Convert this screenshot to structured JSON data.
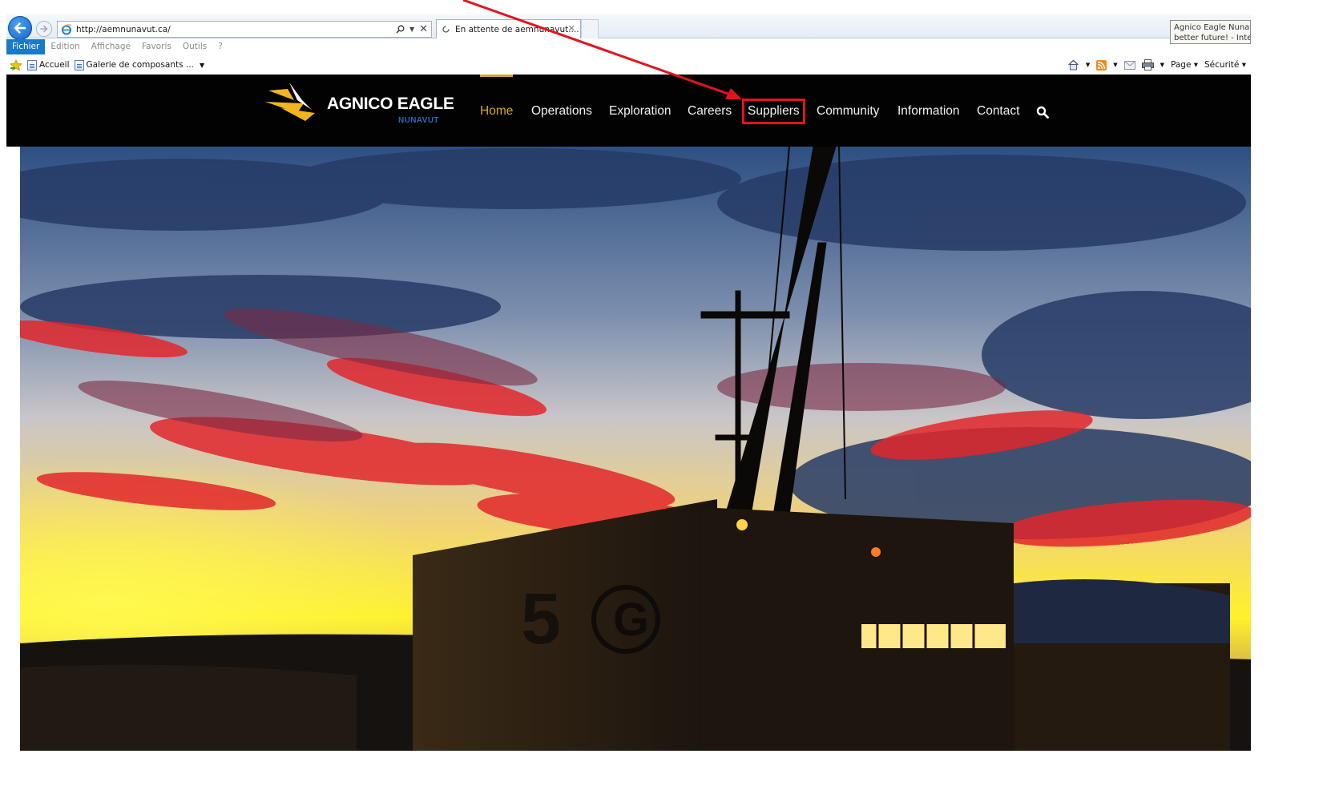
{
  "browser": {
    "url": "http://aemnunavut.ca/",
    "tab_title": "En attente de aemnunavut....",
    "tooltip_line1": "Agnico Eagle Nunavut",
    "tooltip_line2": "better future! - Internet",
    "menu": [
      "Fichier",
      "Edition",
      "Affichage",
      "Favoris",
      "Outils",
      "?"
    ],
    "favorites": [
      "Accueil",
      "Galerie de composants ..."
    ],
    "command_bar": {
      "page": "Page",
      "security": "Sécurité"
    }
  },
  "site": {
    "logo_title": "AGNICO EAGLE",
    "logo_subtitle": "NUNAVUT",
    "nav": [
      "Home",
      "Operations",
      "Exploration",
      "Careers",
      "Suppliers",
      "Community",
      "Information",
      "Contact"
    ],
    "active_nav": "Home",
    "highlighted_nav": "Suppliers"
  },
  "hero": {
    "container_number": "5",
    "container_logo_letter": "G"
  },
  "colors": {
    "nav_active": "#d8a624",
    "header_bg": "#020202",
    "annotation": "#e1141c",
    "logo_sub": "#2a6ab6"
  },
  "icons": [
    "back-arrow-icon",
    "forward-arrow-icon",
    "ie-logo-icon",
    "search-icon",
    "loading-icon",
    "close-icon",
    "favorites-star-icon",
    "page-icon",
    "home-icon",
    "rss-icon",
    "mail-icon",
    "print-icon"
  ]
}
